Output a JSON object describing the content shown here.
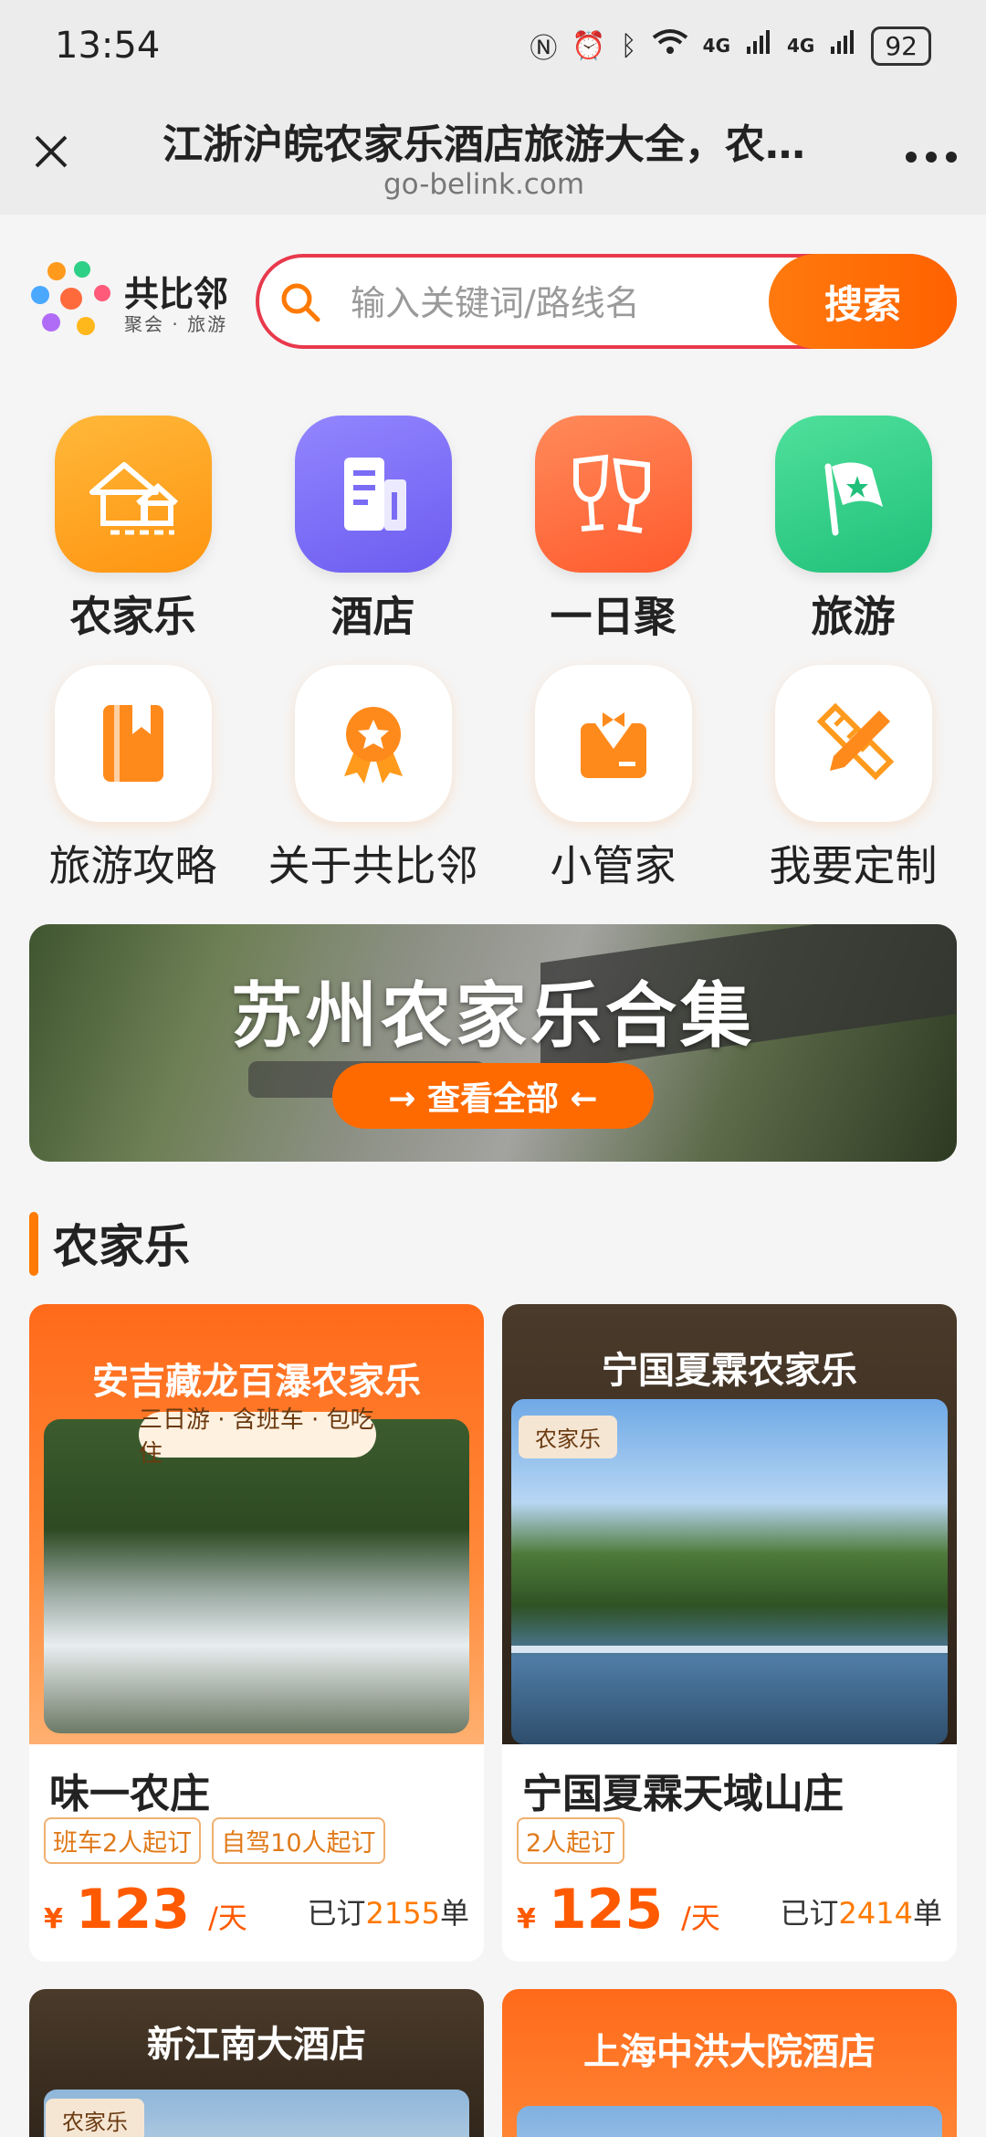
{
  "status_bar": {
    "time": "13:54",
    "network1": "4G",
    "network2": "4G",
    "battery": "92"
  },
  "titlebar": {
    "title": "江浙沪皖农家乐酒店旅游大全，农…",
    "url": "go-belink.com"
  },
  "brand": {
    "name": "共比邻",
    "tagline": "聚会 · 旅游"
  },
  "search": {
    "placeholder": "输入关键词/路线名",
    "button": "搜索"
  },
  "categories_main": [
    {
      "label": "农家乐",
      "icon": "farmhouse-icon",
      "color": "#ffa41c"
    },
    {
      "label": "酒店",
      "icon": "hotel-building-icon",
      "color": "#7b6cf6"
    },
    {
      "label": "一日聚",
      "icon": "wine-glasses-icon",
      "color": "#ff6a3d"
    },
    {
      "label": "旅游",
      "icon": "flag-icon",
      "color": "#2ecf86"
    }
  ],
  "categories_secondary": [
    {
      "label": "旅游攻略",
      "icon": "guidebook-icon"
    },
    {
      "label": "关于共比邻",
      "icon": "award-medal-icon"
    },
    {
      "label": "小管家",
      "icon": "butler-icon"
    },
    {
      "label": "我要定制",
      "icon": "pencil-ruler-icon"
    }
  ],
  "banner": {
    "title": "苏州农家乐合集",
    "button": "→ 查看全部 ←"
  },
  "section": {
    "title": "农家乐"
  },
  "cards": [
    {
      "image_title": "安吉藏龙百瀑农家乐",
      "image_badge": "三日游 · 含班车 · 包吃住",
      "name": "味一农庄",
      "tags": [
        "班车2人起订",
        "自驾10人起订"
      ],
      "currency": "¥",
      "price": "123",
      "unit": "/天",
      "sold_prefix": "已订",
      "sold_count": "2155",
      "sold_suffix": "单"
    },
    {
      "image_title": "宁国夏霖农家乐",
      "image_tag": "农家乐",
      "name": "宁国夏霖天域山庄",
      "tags": [
        "2人起订"
      ],
      "currency": "¥",
      "price": "125",
      "unit": "/天",
      "sold_prefix": "已订",
      "sold_count": "2414",
      "sold_suffix": "单"
    },
    {
      "image_title": "新江南大酒店",
      "image_tag": "农家乐"
    },
    {
      "image_title": "上海中洪大院酒店"
    }
  ]
}
